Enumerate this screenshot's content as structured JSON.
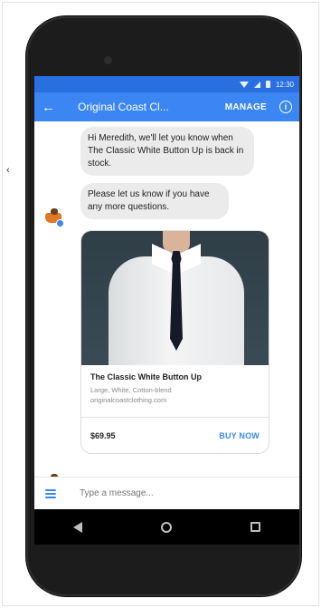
{
  "stray_char": "‹",
  "status_bar": {
    "time": "12:30"
  },
  "app_bar": {
    "title": "Original Coast Cl...",
    "manage_label": "MANAGE",
    "info_label": "i"
  },
  "messages": [
    {
      "text": "Hi Meredith, we'll let you know when The Classic White Button Up is back in stock."
    },
    {
      "text": "Please let us know if you have any more questions."
    }
  ],
  "product_card": {
    "title": "The Classic White Button Up",
    "subtitle_line1": "Large, White, Cotton-blend",
    "subtitle_line2": "originalcoastclothing.com",
    "price": "$69.95",
    "buy_label": "BUY NOW"
  },
  "composer": {
    "placeholder": "Type a message..."
  },
  "colors": {
    "status_bar": "#2a6fe0",
    "app_bar": "#3b86f2",
    "bubble": "#ebebeb",
    "accent": "#3b86f2"
  }
}
